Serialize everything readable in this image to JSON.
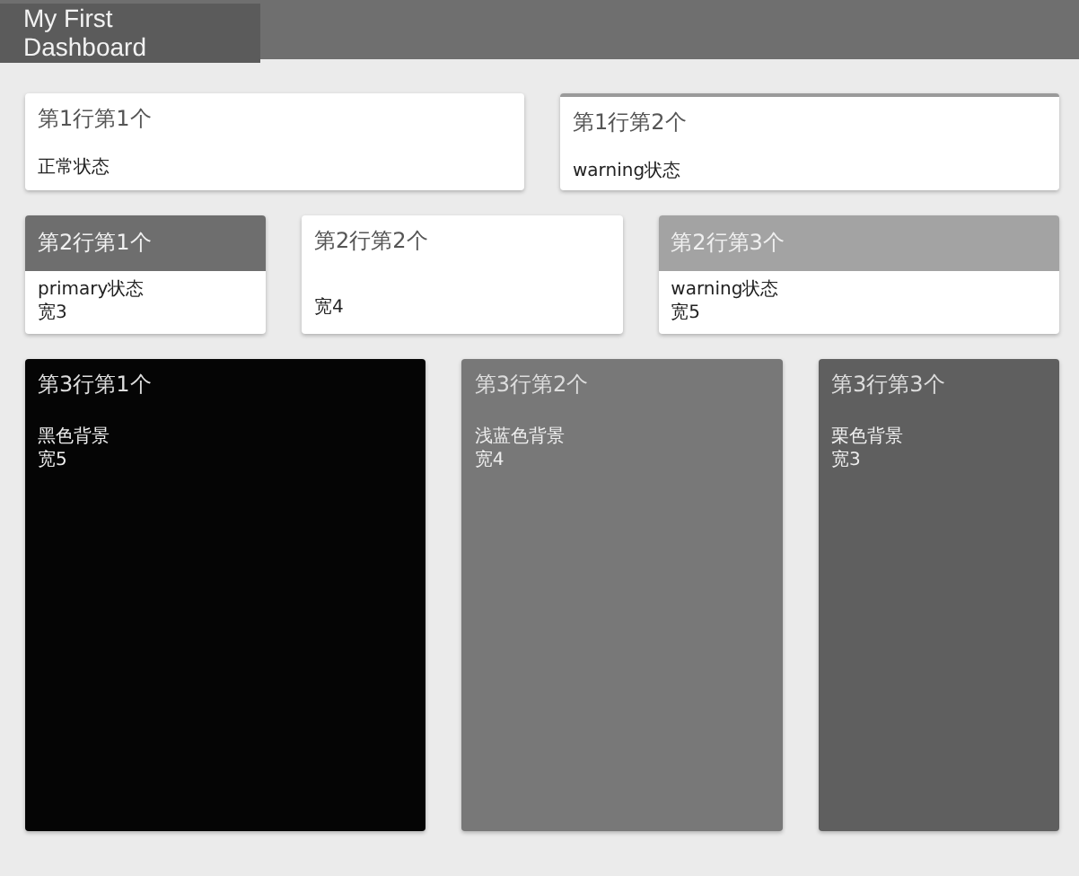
{
  "header": {
    "title": "My First Dashboard"
  },
  "rows": [
    {
      "cards": [
        {
          "kind": "plain",
          "title": "第1行第1个",
          "lines": [
            "正常状态"
          ]
        },
        {
          "kind": "topline",
          "color": "#9a9a9a",
          "title": "第1行第2个",
          "lines": [
            "warning状态"
          ]
        }
      ]
    },
    {
      "cards": [
        {
          "kind": "headed",
          "color": "#6e6e6e",
          "title": "第2行第1个",
          "lines": [
            "primary状态",
            "宽3"
          ]
        },
        {
          "kind": "plain",
          "title": "第2行第2个",
          "lines": [
            "宽4"
          ]
        },
        {
          "kind": "headed",
          "color": "#a3a3a3",
          "title": "第2行第3个",
          "lines": [
            "warning状态",
            "宽5"
          ]
        }
      ]
    },
    {
      "cards": [
        {
          "kind": "filled",
          "color": "#050505",
          "title": "第3行第1个",
          "lines": [
            "黑色背景",
            "宽5"
          ]
        },
        {
          "kind": "filled",
          "color": "#787878",
          "title": "第3行第2个",
          "lines": [
            "浅蓝色背景",
            "宽4"
          ]
        },
        {
          "kind": "filled",
          "color": "#5f5f5f",
          "title": "第3行第3个",
          "lines": [
            "栗色背景",
            "宽3"
          ]
        }
      ]
    }
  ]
}
